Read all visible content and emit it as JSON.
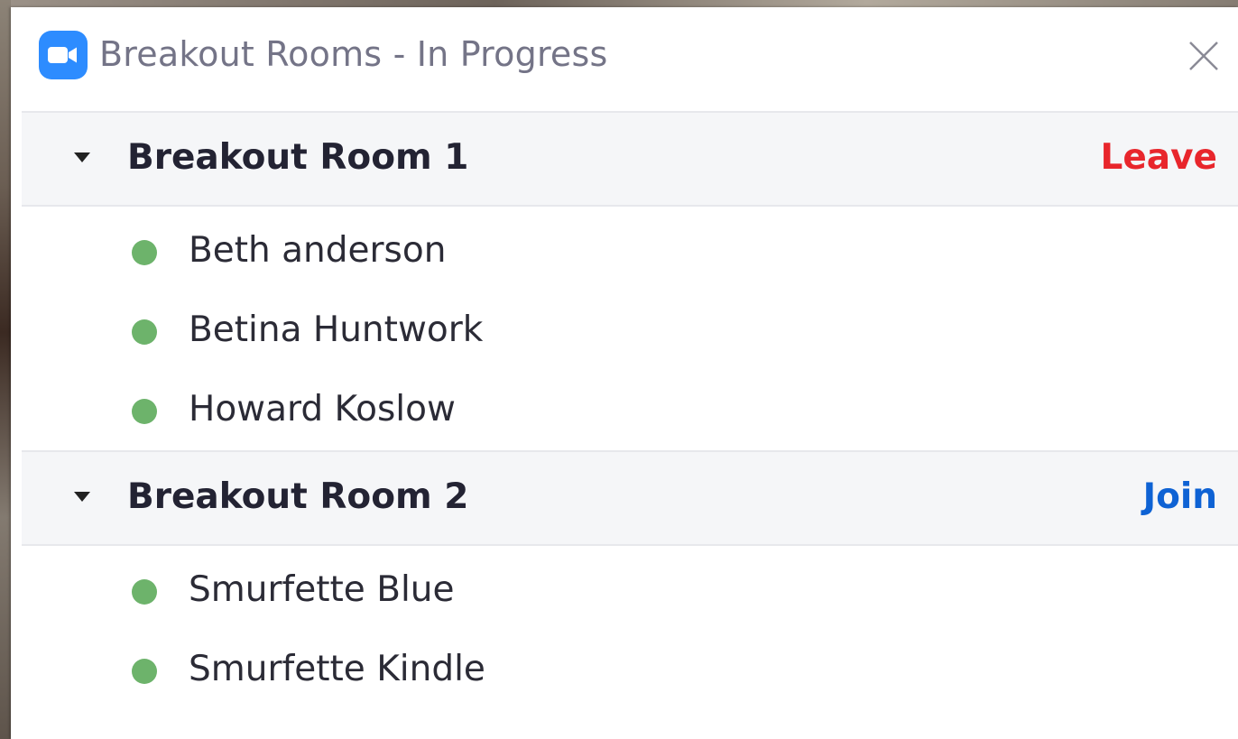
{
  "window": {
    "title": "Breakout Rooms - In Progress",
    "app_icon": "zoom-camera-icon",
    "close_icon": "close-icon"
  },
  "colors": {
    "leave": "#e8262c",
    "join": "#0e62d4",
    "status_online": "#6db36b",
    "header_bg": "#f5f6f8",
    "title_text": "#747487"
  },
  "rooms": [
    {
      "name": "Breakout Room 1",
      "action_label": "Leave",
      "action_type": "leave",
      "participants": [
        {
          "name": "Beth anderson"
        },
        {
          "name": "Betina Huntwork"
        },
        {
          "name": "Howard Koslow"
        }
      ]
    },
    {
      "name": "Breakout Room 2",
      "action_label": "Join",
      "action_type": "join",
      "participants": [
        {
          "name": "Smurfette Blue"
        },
        {
          "name": "Smurfette Kindle"
        }
      ]
    }
  ]
}
